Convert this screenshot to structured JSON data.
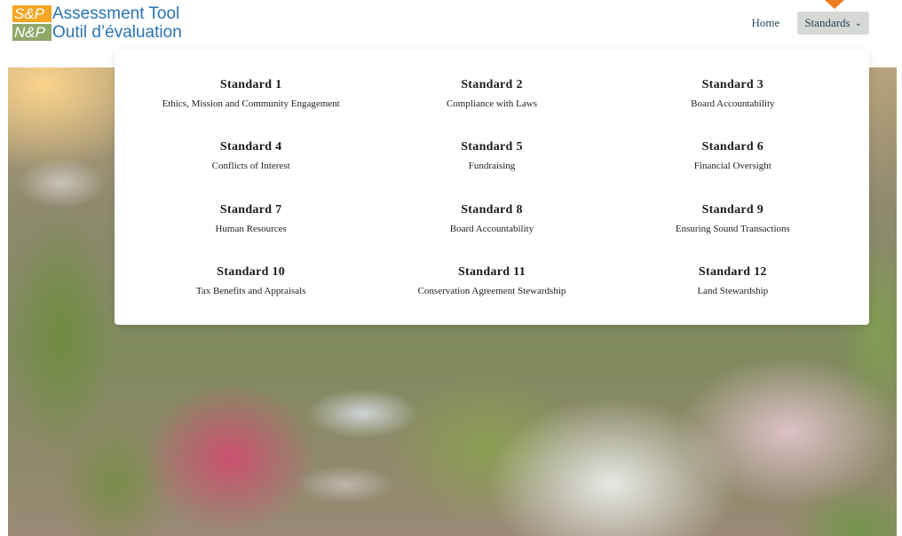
{
  "logo": {
    "line1_badge": "S&P",
    "line1_text": "Assessment Tool",
    "line2_badge": "N&P",
    "line2_text": "Outil d’évaluation"
  },
  "nav": {
    "home": "Home",
    "standards": "Standards"
  },
  "standards": [
    {
      "title": "Standard 1",
      "subtitle": "Ethics, Mission and Community Engagement"
    },
    {
      "title": "Standard 2",
      "subtitle": "Compliance with Laws"
    },
    {
      "title": "Standard 3",
      "subtitle": "Board Accountability"
    },
    {
      "title": "Standard 4",
      "subtitle": "Conflicts of Interest"
    },
    {
      "title": "Standard 5",
      "subtitle": "Fundraising"
    },
    {
      "title": "Standard 6",
      "subtitle": "Financial Oversight"
    },
    {
      "title": "Standard 7",
      "subtitle": "Human Resources"
    },
    {
      "title": "Standard 8",
      "subtitle": "Board Accountability"
    },
    {
      "title": "Standard 9",
      "subtitle": "Ensuring Sound Transactions"
    },
    {
      "title": "Standard 10",
      "subtitle": "Tax Benefits and Appraisals"
    },
    {
      "title": "Standard 11",
      "subtitle": "Conservation Agreement Stewardship"
    },
    {
      "title": "Standard 12",
      "subtitle": "Land Stewardship"
    }
  ],
  "colors": {
    "brand_blue": "#2b74b3",
    "badge_orange": "#f5a623",
    "badge_green": "#8ea86a",
    "accent_orange": "#f07b1d"
  },
  "icons": {
    "dropdown": "chevron-down-icon",
    "active_marker": "caret-down-icon"
  }
}
